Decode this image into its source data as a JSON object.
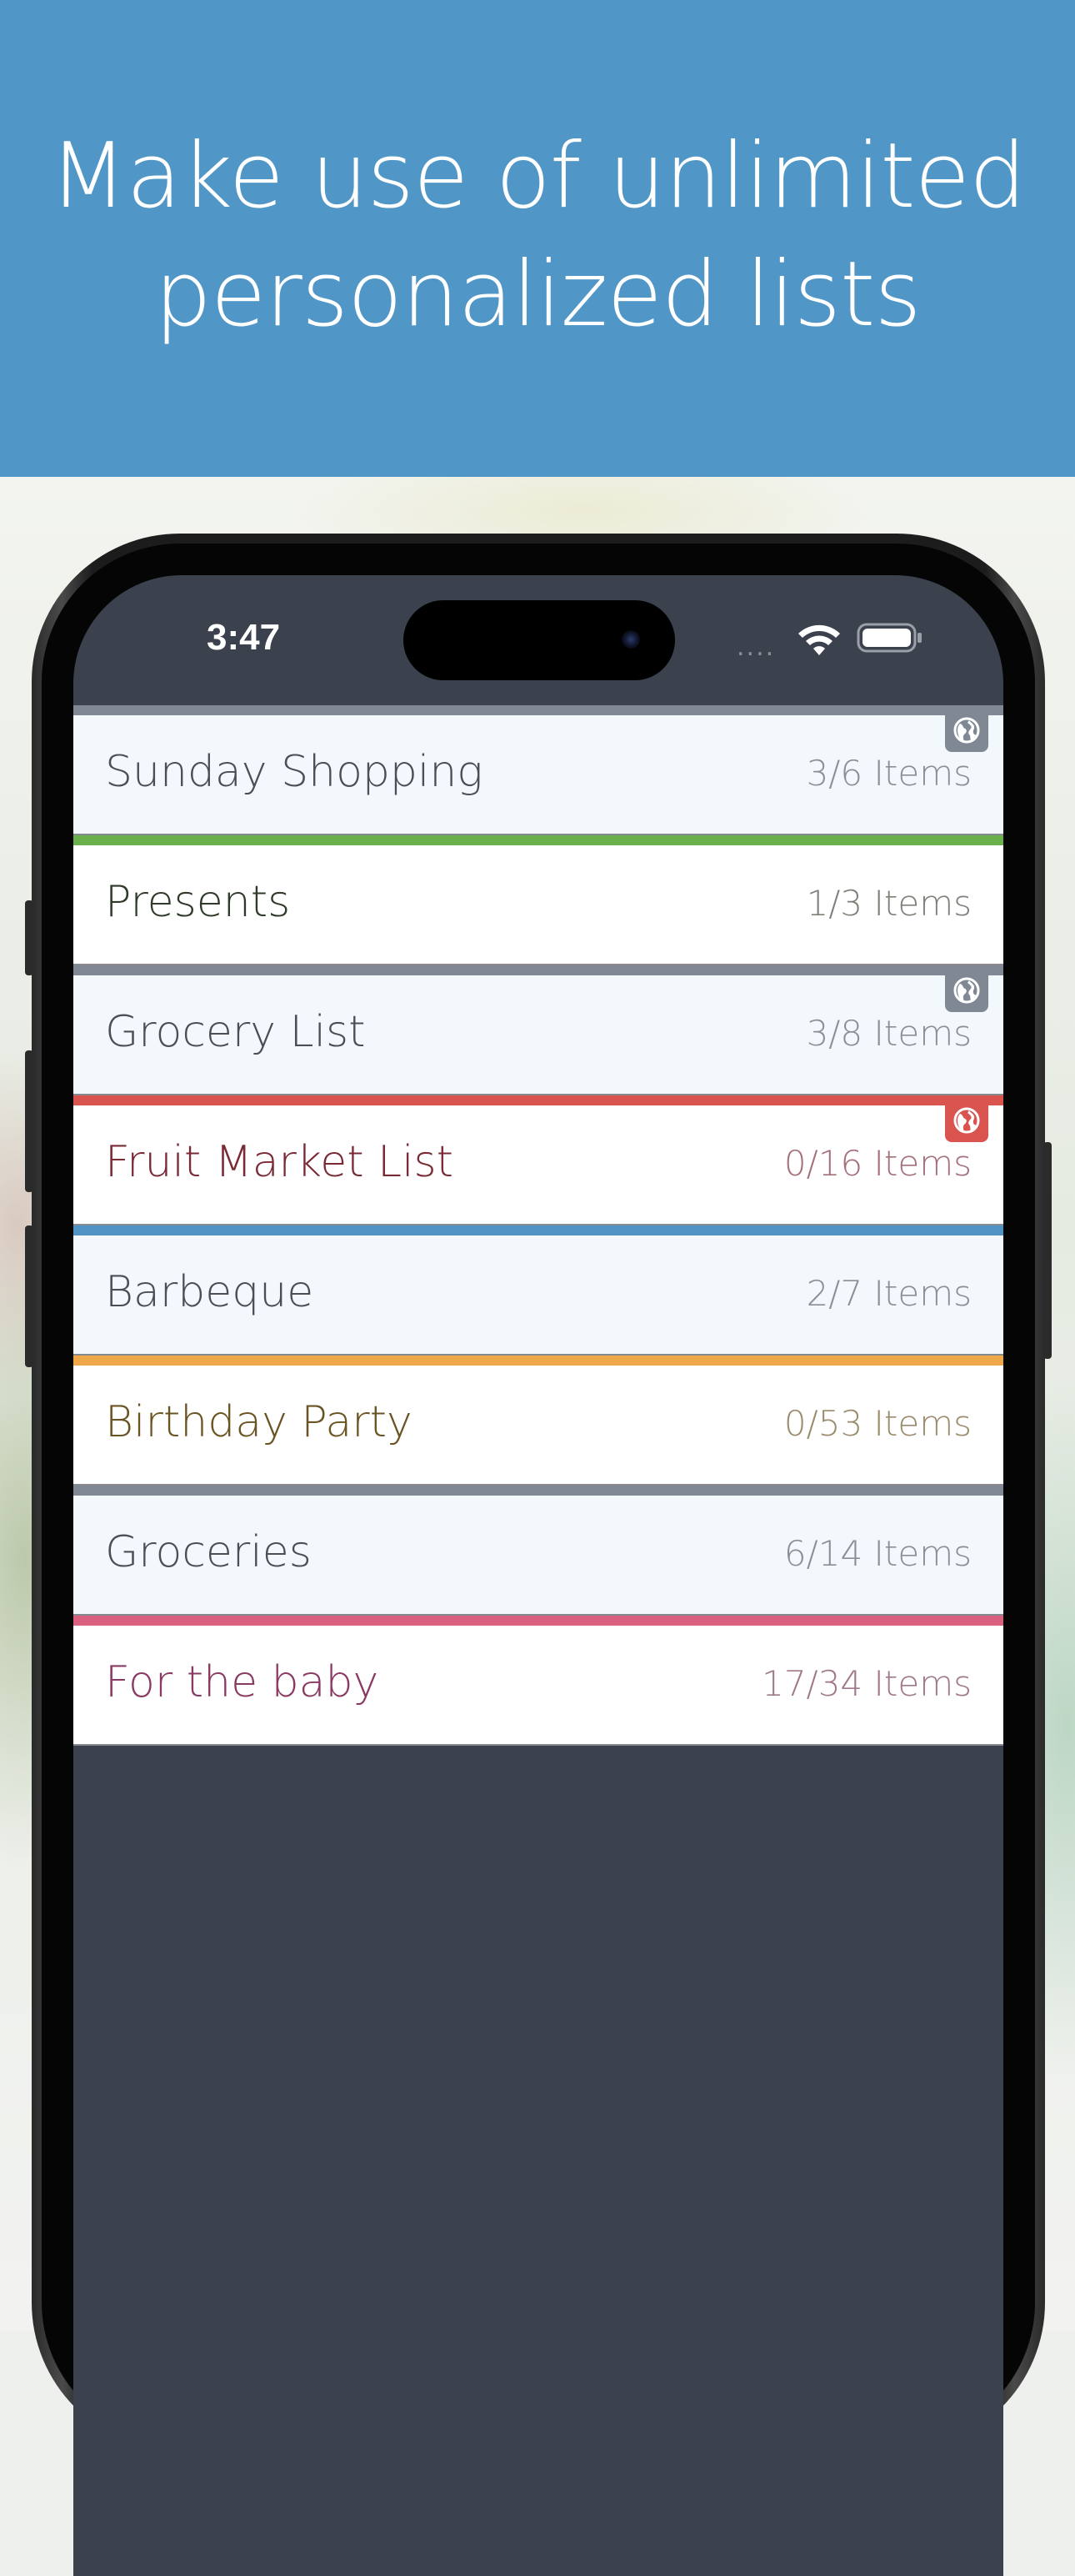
{
  "header": {
    "title_line1": "Make use of unlimited",
    "title_line2": "personalized lists",
    "background": "#5096c6"
  },
  "status_bar": {
    "time": "3:47",
    "signal": "....",
    "wifi_icon": "wifi-icon",
    "battery_icon": "battery-icon"
  },
  "lists": [
    {
      "name": "Sunday Shopping",
      "count": "3/6 Items",
      "color": "#7f8893",
      "bg": "#f3f8fc",
      "text_color": "#4a4f57",
      "count_color": "#8a8f96",
      "shared": true,
      "badge_color": "#7f8893"
    },
    {
      "name": "Presents",
      "count": "1/3 Items",
      "color": "#6ab04c",
      "bg": "#ffffff",
      "text_color": "#2f3a2a",
      "count_color": "#7c8278",
      "shared": false
    },
    {
      "name": "Grocery List",
      "count": "3/8 Items",
      "color": "#7f8893",
      "bg": "#f3f8fc",
      "text_color": "#4a4f57",
      "count_color": "#8a8f96",
      "shared": true,
      "badge_color": "#7f8893"
    },
    {
      "name": "Fruit Market List",
      "count": "0/16 Items",
      "color": "#d9534f",
      "bg": "#ffffff",
      "text_color": "#7a2a35",
      "count_color": "#a5707a",
      "shared": true,
      "badge_color": "#d9534f"
    },
    {
      "name": "Barbeque",
      "count": "2/7 Items",
      "color": "#4f93c4",
      "bg": "#f3f8fc",
      "text_color": "#4a4f57",
      "count_color": "#8a8f96",
      "shared": false
    },
    {
      "name": "Birthday Party",
      "count": "0/53 Items",
      "color": "#eea84a",
      "bg": "#ffffff",
      "text_color": "#6b5423",
      "count_color": "#9a8c6c",
      "shared": false
    },
    {
      "name": "Groceries",
      "count": "6/14 Items",
      "color": "#7f8893",
      "bg": "#f3f8fc",
      "text_color": "#4a4f57",
      "count_color": "#8a8f96",
      "shared": false
    },
    {
      "name": "For the baby",
      "count": "17/34 Items",
      "color": "#d9607e",
      "bg": "#ffffff",
      "text_color": "#8a3a62",
      "count_color": "#a0788c",
      "shared": false
    }
  ]
}
